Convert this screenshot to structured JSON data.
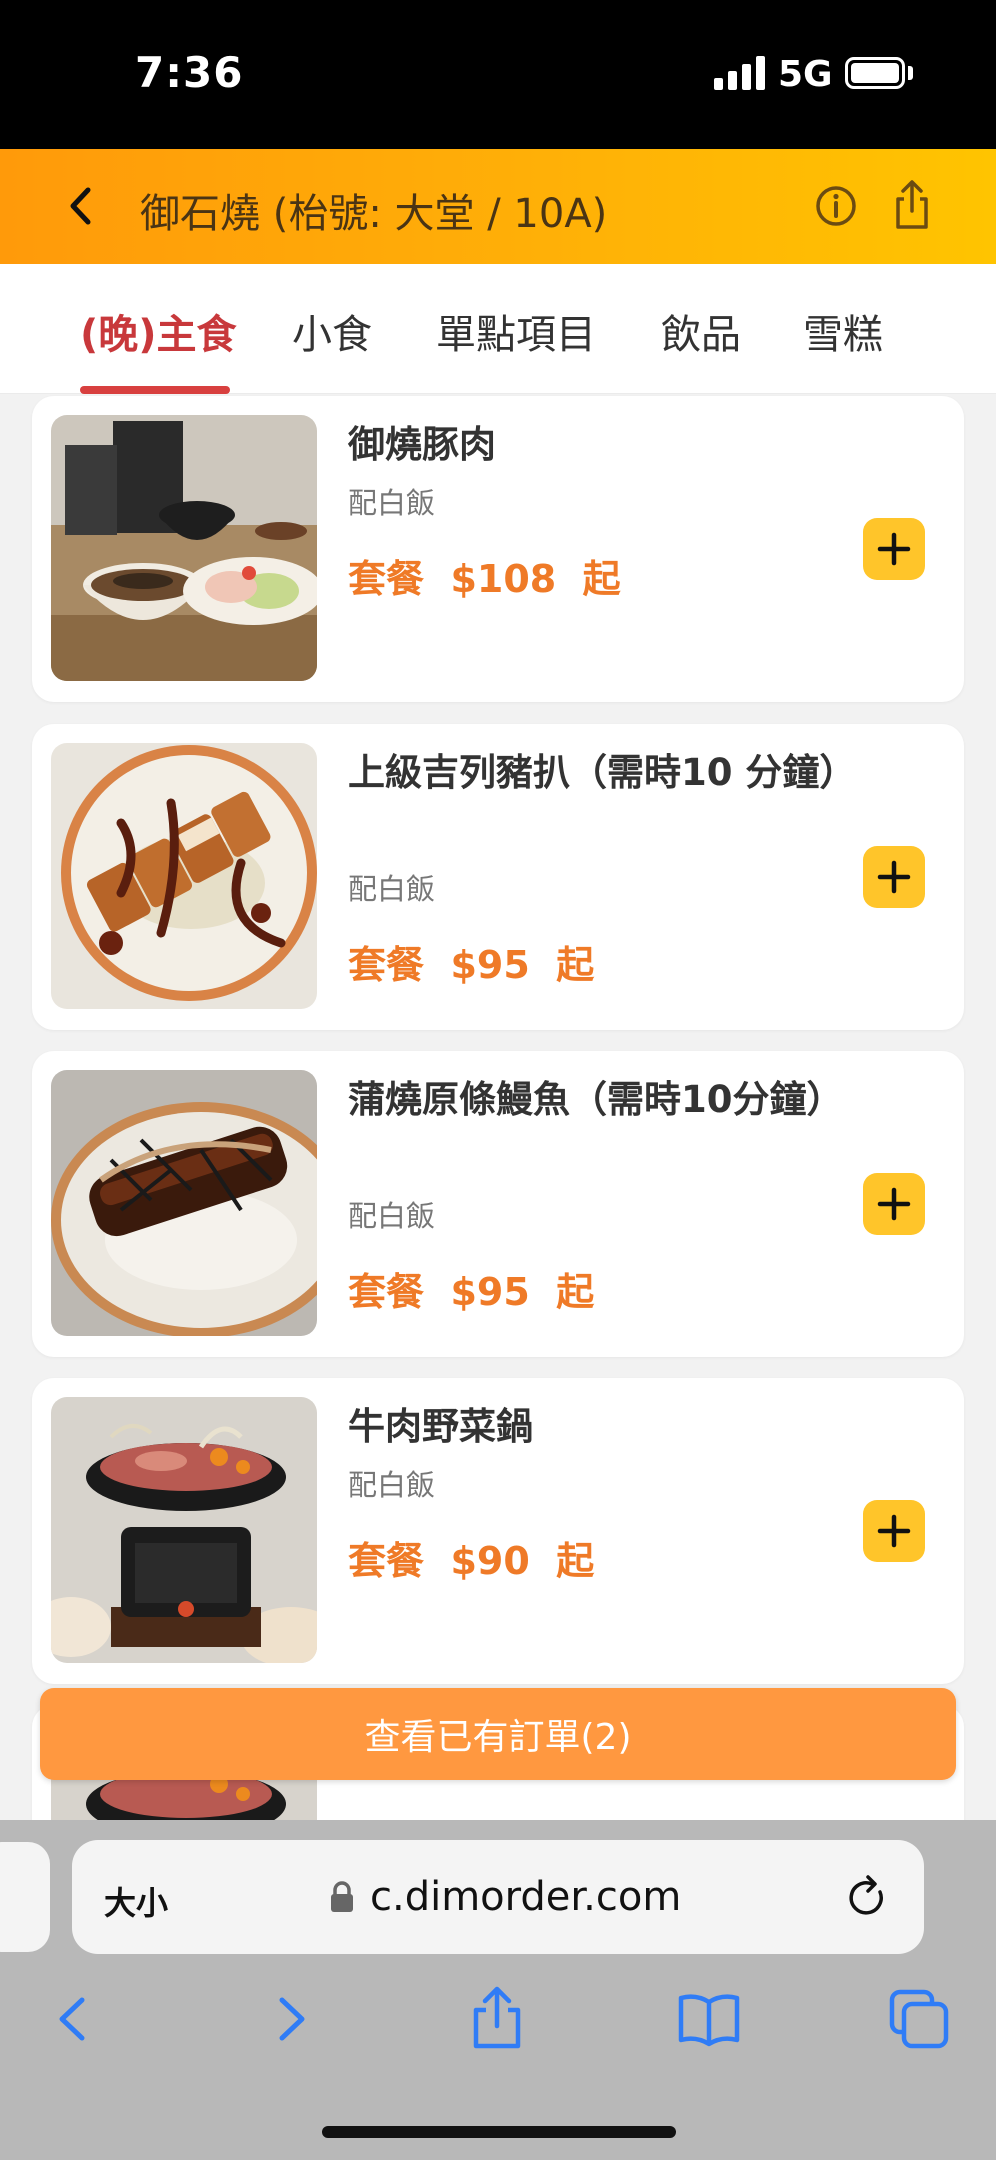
{
  "status_bar": {
    "time": "7:36",
    "network": "5G"
  },
  "header": {
    "title": "御石燒 (枱號: 大堂 / 10A)"
  },
  "tabs": [
    {
      "label": "(晚)主食",
      "active": true
    },
    {
      "label": "小食"
    },
    {
      "label": "單點項目"
    },
    {
      "label": "飲品"
    },
    {
      "label": "雪糕"
    }
  ],
  "menu": {
    "items": [
      {
        "name": "御燒豚肉",
        "subtitle": "配白飯",
        "price": "套餐  $108  起"
      },
      {
        "name": "上級吉列豬扒（需時10 分鐘）",
        "subtitle": "配白飯",
        "price": "套餐  $95  起"
      },
      {
        "name": "蒲燒原條鰻魚（需時10分鐘）",
        "subtitle": "配白飯",
        "price": "套餐  $95  起"
      },
      {
        "name": "牛肉野菜鍋",
        "subtitle": "配白飯",
        "price": "套餐  $90  起"
      }
    ]
  },
  "view_order_label": "查看已有訂單(2)",
  "browser": {
    "text_size_label": "大小",
    "url": "c.dimorder.com"
  },
  "colors": {
    "accent": "#ef7a27",
    "active_tab": "#c8383b",
    "add_button": "#ffc52a",
    "order_button": "#ff9840",
    "header_gradient_start": "#ff9a0a",
    "header_gradient_end": "#ffc400",
    "browser_blue": "#2f7cf6"
  }
}
